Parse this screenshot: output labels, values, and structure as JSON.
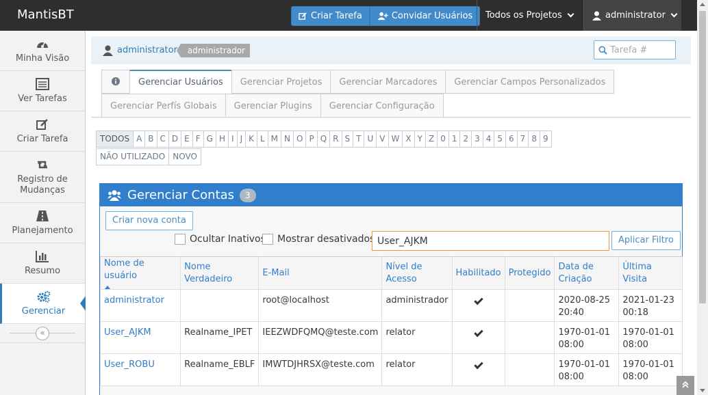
{
  "app": {
    "brand": "MantisBT"
  },
  "navbar": {
    "report_label": "Criar Tarefa",
    "invite_label": "Convidar Usuários",
    "projects_label": "Todos os Projetos",
    "user_label": "administrator"
  },
  "sidebar": {
    "items": [
      {
        "label": "Minha Visão",
        "icon": "dashboard-icon"
      },
      {
        "label": "Ver Tarefas",
        "icon": "list-icon"
      },
      {
        "label": "Criar Tarefa",
        "icon": "edit-icon"
      },
      {
        "label": "Registro de Mudanças",
        "icon": "retweet-icon"
      },
      {
        "label": "Planejamento",
        "icon": "road-icon"
      },
      {
        "label": "Resumo",
        "icon": "bar-chart-icon"
      },
      {
        "label": "Gerenciar",
        "icon": "gears-icon",
        "active": true
      }
    ],
    "collapse_glyph": "«"
  },
  "breadcrumb": {
    "user_link": "administrator",
    "role_tag": "administrador"
  },
  "search": {
    "placeholder": "Tarefa #"
  },
  "tabs": {
    "row1": [
      "Gerenciar Usuários",
      "Gerenciar Projetos",
      "Gerenciar Marcadores",
      "Gerenciar Campos Personalizados"
    ],
    "row2": [
      "Gerenciar Perfís Globais",
      "Gerenciar Plugins",
      "Gerenciar Configuração"
    ],
    "active": "Gerenciar Usuários"
  },
  "alphabet": {
    "row1": [
      "TODOS",
      "A",
      "B",
      "C",
      "D",
      "E",
      "F",
      "G",
      "H",
      "I",
      "J",
      "K",
      "L",
      "M",
      "N",
      "O",
      "P",
      "Q",
      "R",
      "S",
      "T",
      "U",
      "V",
      "W",
      "X",
      "Y",
      "Z",
      "0",
      "1",
      "2",
      "3",
      "4",
      "5",
      "6",
      "7",
      "8",
      "9"
    ],
    "row2": [
      "NÃO UTILIZADO",
      "NOVO"
    ],
    "selected": "TODOS"
  },
  "accounts": {
    "title": "Gerenciar Contas",
    "count": "3",
    "create_label": "Criar nova conta",
    "hide_inactive_label": "Ocultar Inativos",
    "show_disabled_label": "Mostrar desativados",
    "filter_value": "User_AJKM",
    "apply_label": "Aplicar Filtro",
    "columns": [
      "Nome de usuário",
      "Nome Verdadeiro",
      "E-Mail",
      "Nível de Acesso",
      "Habilitado",
      "Protegido",
      "Data de Criação",
      "Última Visita"
    ],
    "rows": [
      {
        "username": "administrator",
        "realname": "",
        "email": "root@localhost",
        "access": "administrador",
        "enabled": true,
        "protected": false,
        "created": "2020-08-25 20:40",
        "last_visit": "2021-01-23 00:18"
      },
      {
        "username": "User_AJKM",
        "realname": "Realname_IPET",
        "email": "IEEZWDFQMQ@teste.com",
        "access": "relator",
        "enabled": true,
        "protected": false,
        "created": "1970-01-01 08:00",
        "last_visit": "1970-01-01 08:00"
      },
      {
        "username": "User_ROBU",
        "realname": "Realname_EBLF",
        "email": "IMWTDJHRSX@teste.com",
        "access": "relator",
        "enabled": true,
        "protected": false,
        "created": "1970-01-01 08:00",
        "last_visit": "1970-01-01 08:00"
      }
    ]
  },
  "colors": {
    "primary": "#307ecc",
    "navbar": "#2e2e2e",
    "button": "#428bca",
    "filter_border": "#f59942"
  }
}
